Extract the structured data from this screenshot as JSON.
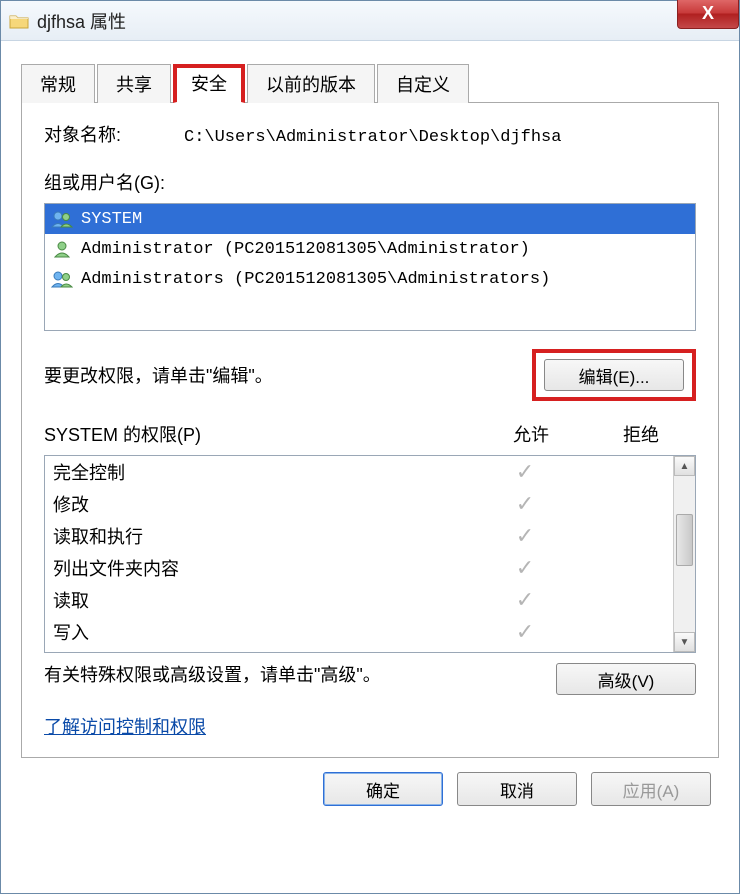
{
  "title": "djfhsa 属性",
  "close_symbol": "X",
  "tabs": {
    "general": "常规",
    "sharing": "共享",
    "security": "安全",
    "previous": "以前的版本",
    "custom": "自定义",
    "active": "security"
  },
  "object": {
    "label": "对象名称:",
    "path": "C:\\Users\\Administrator\\Desktop\\djfhsa"
  },
  "groups": {
    "label": "组或用户名(G):",
    "items": [
      {
        "name": "SYSTEM",
        "selected": true,
        "icon": "group"
      },
      {
        "name": "Administrator (PC201512081305\\Administrator)",
        "selected": false,
        "icon": "user"
      },
      {
        "name": "Administrators (PC201512081305\\Administrators)",
        "selected": false,
        "icon": "group"
      }
    ]
  },
  "edit": {
    "hint": "要更改权限，请单击\"编辑\"。",
    "button": "编辑(E)..."
  },
  "permissions": {
    "header_name": "SYSTEM 的权限(P)",
    "header_allow": "允许",
    "header_deny": "拒绝",
    "rows": [
      {
        "name": "完全控制",
        "allow": true,
        "deny": false
      },
      {
        "name": "修改",
        "allow": true,
        "deny": false
      },
      {
        "name": "读取和执行",
        "allow": true,
        "deny": false
      },
      {
        "name": "列出文件夹内容",
        "allow": true,
        "deny": false
      },
      {
        "name": "读取",
        "allow": true,
        "deny": false
      },
      {
        "name": "写入",
        "allow": true,
        "deny": false
      }
    ]
  },
  "advanced": {
    "hint": "有关特殊权限或高级设置，请单击\"高级\"。",
    "button": "高级(V)"
  },
  "link": "了解访问控制和权限",
  "buttons": {
    "ok": "确定",
    "cancel": "取消",
    "apply": "应用(A)"
  }
}
